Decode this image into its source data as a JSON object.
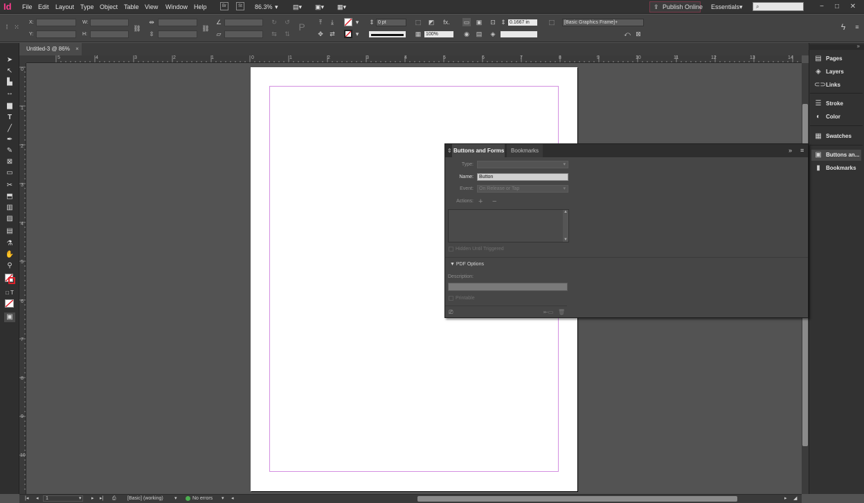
{
  "app": {
    "logo": "Id",
    "accent": "#ff3c8e"
  },
  "menu": [
    "File",
    "Edit",
    "Layout",
    "Type",
    "Object",
    "Table",
    "View",
    "Window",
    "Help"
  ],
  "menubar": {
    "bridge_label": "Br",
    "stock_label": "St",
    "zoom": "86.3%",
    "publish_label": "Publish Online",
    "workspace": "Essentials",
    "search_placeholder": ""
  },
  "control": {
    "x_label": "X:",
    "y_label": "Y:",
    "w_label": "W:",
    "h_label": "H:",
    "stroke_weight": "0 pt",
    "opacity": "100%",
    "fitting_offset": "0.1667 in",
    "object_style": "[Basic Graphics Frame]+",
    "fx_label": "fx."
  },
  "document": {
    "tab_title": "Untitled-3 @ 86%",
    "close_glyph": "×"
  },
  "rulers": {
    "horizontal": [
      "5",
      "4",
      "3",
      "2",
      "1",
      "0",
      "1",
      "2",
      "3",
      "4",
      "5",
      "6",
      "7",
      "8",
      "9",
      "10",
      "11",
      "12",
      "13",
      "14"
    ],
    "vertical": [
      "0",
      "1",
      "2",
      "3",
      "4",
      "5",
      "6",
      "7",
      "8",
      "9",
      "10"
    ]
  },
  "dock": [
    {
      "label": "Pages",
      "icon": "pages-icon"
    },
    {
      "label": "Layers",
      "icon": "layers-icon"
    },
    {
      "label": "Links",
      "icon": "links-icon"
    },
    {
      "label": "Stroke",
      "icon": "stroke-icon"
    },
    {
      "label": "Color",
      "icon": "color-icon"
    },
    {
      "label": "Swatches",
      "icon": "swatches-icon"
    },
    {
      "label": "Buttons an...",
      "icon": "buttons-icon"
    },
    {
      "label": "Bookmarks",
      "icon": "bookmarks-icon"
    }
  ],
  "panel": {
    "tab_active": "Buttons and Forms",
    "tab_inactive": "Bookmarks",
    "type_label": "Type:",
    "name_label": "Name:",
    "name_value": "Button",
    "event_label": "Event:",
    "event_value": "On Release or Tap",
    "actions_label": "Actions:",
    "hidden_label": "Hidden Until Triggered",
    "pdf_options_label": "PDF Options",
    "description_label": "Description:",
    "printable_label": "Printable"
  },
  "status": {
    "page_number": "1",
    "preflight_profile": "[Basic] (working)",
    "errors": "No errors",
    "ok_color": "#4caf50"
  }
}
